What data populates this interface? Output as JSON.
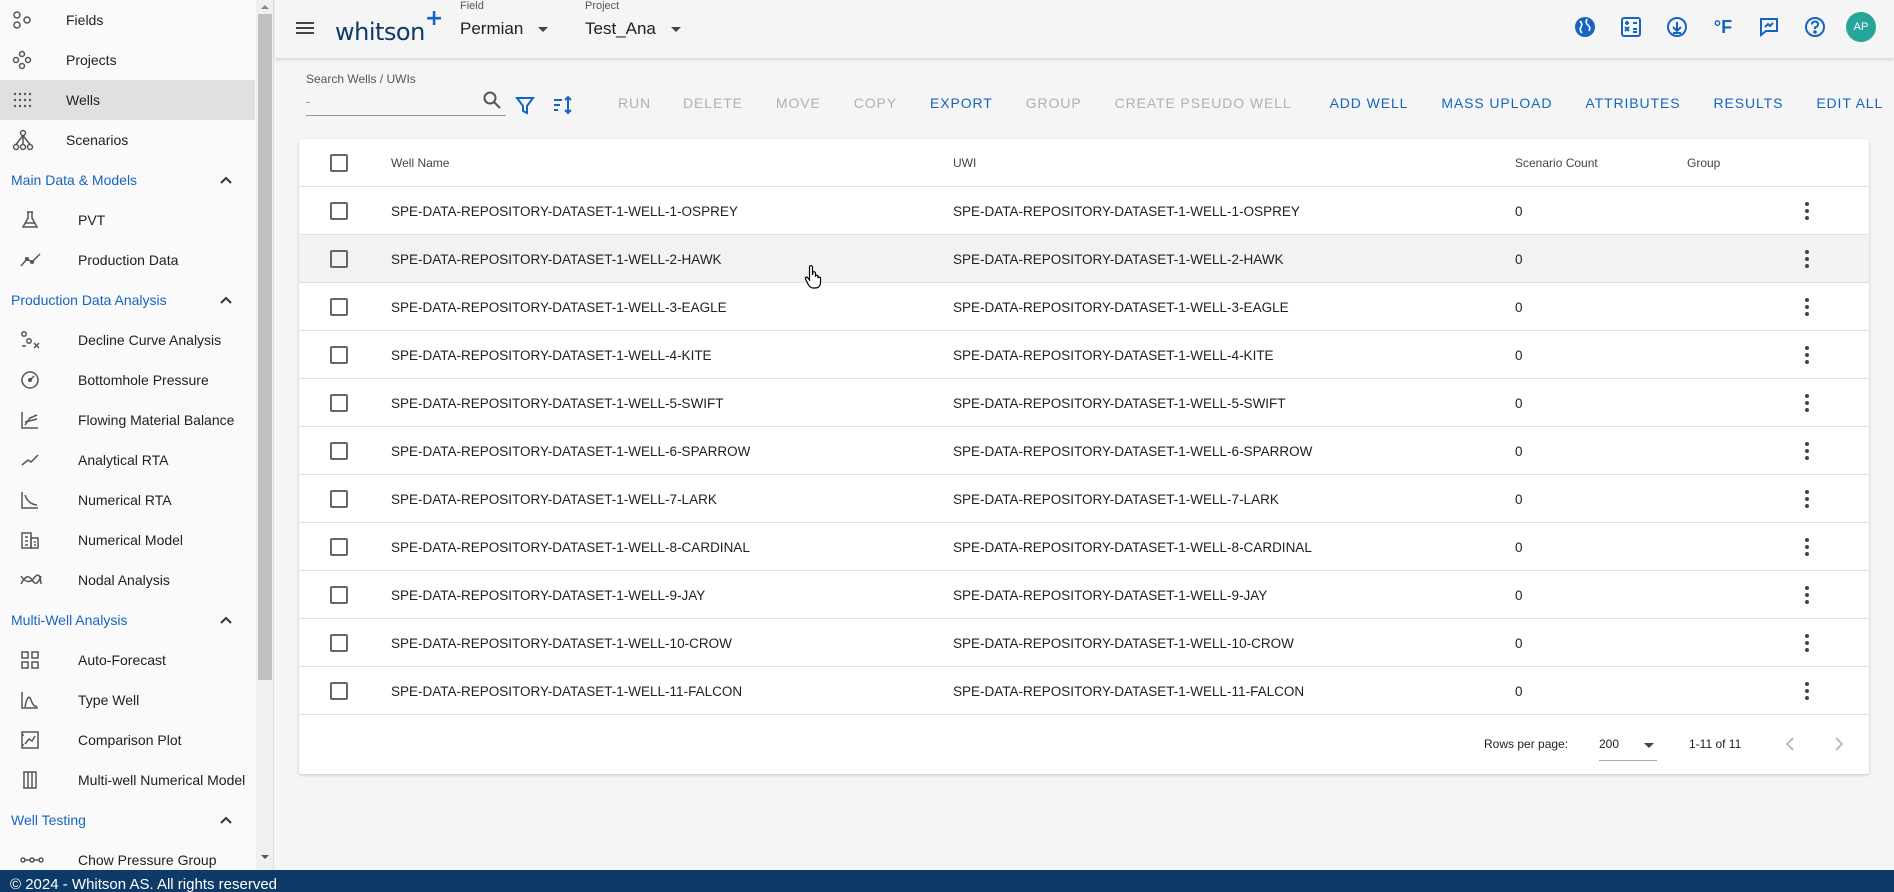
{
  "sidebar": {
    "top_items": [
      {
        "label": "Fields",
        "icon": "fields-icon"
      },
      {
        "label": "Projects",
        "icon": "projects-icon"
      },
      {
        "label": "Wells",
        "icon": "wells-grid-icon",
        "active": true
      },
      {
        "label": "Scenarios",
        "icon": "scenarios-tree-icon"
      }
    ],
    "sections": [
      {
        "title": "Main Data & Models",
        "items": [
          {
            "label": "PVT",
            "icon": "flask-icon"
          },
          {
            "label": "Production Data",
            "icon": "line-chart-icon"
          }
        ]
      },
      {
        "title": "Production Data Analysis",
        "items": [
          {
            "label": "Decline Curve Analysis",
            "icon": "decline-curve-icon"
          },
          {
            "label": "Bottomhole Pressure",
            "icon": "gauge-icon"
          },
          {
            "label": "Flowing Material Balance",
            "icon": "material-balance-icon"
          },
          {
            "label": "Analytical RTA",
            "icon": "trend-icon"
          },
          {
            "label": "Numerical RTA",
            "icon": "numerical-rta-icon"
          },
          {
            "label": "Numerical Model",
            "icon": "building-icon"
          },
          {
            "label": "Nodal Analysis",
            "icon": "nodal-icon"
          }
        ]
      },
      {
        "title": "Multi-Well Analysis",
        "items": [
          {
            "label": "Auto-Forecast",
            "icon": "grid-icon"
          },
          {
            "label": "Type Well",
            "icon": "type-well-icon"
          },
          {
            "label": "Comparison Plot",
            "icon": "comparison-icon"
          },
          {
            "label": "Multi-well Numerical Model",
            "icon": "columns-icon"
          }
        ]
      },
      {
        "title": "Well Testing",
        "items": [
          {
            "label": "Chow Pressure Group",
            "icon": "chain-icon"
          }
        ]
      }
    ]
  },
  "topbar": {
    "logo_text": "whitson",
    "logo_plus": "+",
    "field_caption": "Field",
    "field_value": "Permian",
    "project_caption": "Project",
    "project_value": "Test_Ana",
    "units_label": "°F",
    "avatar_initials": "AP"
  },
  "toolbar": {
    "search_caption": "Search Wells / UWIs",
    "search_value": "-",
    "actions": [
      {
        "label": "RUN",
        "enabled": false
      },
      {
        "label": "DELETE",
        "enabled": false
      },
      {
        "label": "MOVE",
        "enabled": false
      },
      {
        "label": "COPY",
        "enabled": false
      },
      {
        "label": "EXPORT",
        "enabled": true
      },
      {
        "label": "GROUP",
        "enabled": false
      },
      {
        "label": "CREATE PSEUDO WELL",
        "enabled": false
      },
      {
        "label": "ADD WELL",
        "enabled": true
      },
      {
        "label": "MASS UPLOAD",
        "enabled": true
      },
      {
        "label": "ATTRIBUTES",
        "enabled": true
      },
      {
        "label": "RESULTS",
        "enabled": true
      },
      {
        "label": "EDIT ALL",
        "enabled": true
      }
    ]
  },
  "table": {
    "headers": {
      "well_name": "Well Name",
      "uwi": "UWI",
      "scenario_count": "Scenario Count",
      "group": "Group"
    },
    "rows": [
      {
        "well_name": "SPE-DATA-REPOSITORY-DATASET-1-WELL-1-OSPREY",
        "uwi": "SPE-DATA-REPOSITORY-DATASET-1-WELL-1-OSPREY",
        "scenario_count": "0",
        "group": ""
      },
      {
        "well_name": "SPE-DATA-REPOSITORY-DATASET-1-WELL-2-HAWK",
        "uwi": "SPE-DATA-REPOSITORY-DATASET-1-WELL-2-HAWK",
        "scenario_count": "0",
        "group": ""
      },
      {
        "well_name": "SPE-DATA-REPOSITORY-DATASET-1-WELL-3-EAGLE",
        "uwi": "SPE-DATA-REPOSITORY-DATASET-1-WELL-3-EAGLE",
        "scenario_count": "0",
        "group": ""
      },
      {
        "well_name": "SPE-DATA-REPOSITORY-DATASET-1-WELL-4-KITE",
        "uwi": "SPE-DATA-REPOSITORY-DATASET-1-WELL-4-KITE",
        "scenario_count": "0",
        "group": ""
      },
      {
        "well_name": "SPE-DATA-REPOSITORY-DATASET-1-WELL-5-SWIFT",
        "uwi": "SPE-DATA-REPOSITORY-DATASET-1-WELL-5-SWIFT",
        "scenario_count": "0",
        "group": ""
      },
      {
        "well_name": "SPE-DATA-REPOSITORY-DATASET-1-WELL-6-SPARROW",
        "uwi": "SPE-DATA-REPOSITORY-DATASET-1-WELL-6-SPARROW",
        "scenario_count": "0",
        "group": ""
      },
      {
        "well_name": "SPE-DATA-REPOSITORY-DATASET-1-WELL-7-LARK",
        "uwi": "SPE-DATA-REPOSITORY-DATASET-1-WELL-7-LARK",
        "scenario_count": "0",
        "group": ""
      },
      {
        "well_name": "SPE-DATA-REPOSITORY-DATASET-1-WELL-8-CARDINAL",
        "uwi": "SPE-DATA-REPOSITORY-DATASET-1-WELL-8-CARDINAL",
        "scenario_count": "0",
        "group": ""
      },
      {
        "well_name": "SPE-DATA-REPOSITORY-DATASET-1-WELL-9-JAY",
        "uwi": "SPE-DATA-REPOSITORY-DATASET-1-WELL-9-JAY",
        "scenario_count": "0",
        "group": ""
      },
      {
        "well_name": "SPE-DATA-REPOSITORY-DATASET-1-WELL-10-CROW",
        "uwi": "SPE-DATA-REPOSITORY-DATASET-1-WELL-10-CROW",
        "scenario_count": "0",
        "group": ""
      },
      {
        "well_name": "SPE-DATA-REPOSITORY-DATASET-1-WELL-11-FALCON",
        "uwi": "SPE-DATA-REPOSITORY-DATASET-1-WELL-11-FALCON",
        "scenario_count": "0",
        "group": ""
      }
    ],
    "hover_row_index": 1,
    "footer": {
      "rows_per_page_label": "Rows per page:",
      "rows_per_page_value": "200",
      "range_text": "1-11 of 11"
    }
  },
  "footer": {
    "copyright": "© 2024 - Whitson AS. All rights reserved"
  },
  "colors": {
    "accent": "#1565c0",
    "brand_dark": "#0d3a66",
    "avatar": "#26a69a",
    "disabled": "#b0b0b0"
  }
}
